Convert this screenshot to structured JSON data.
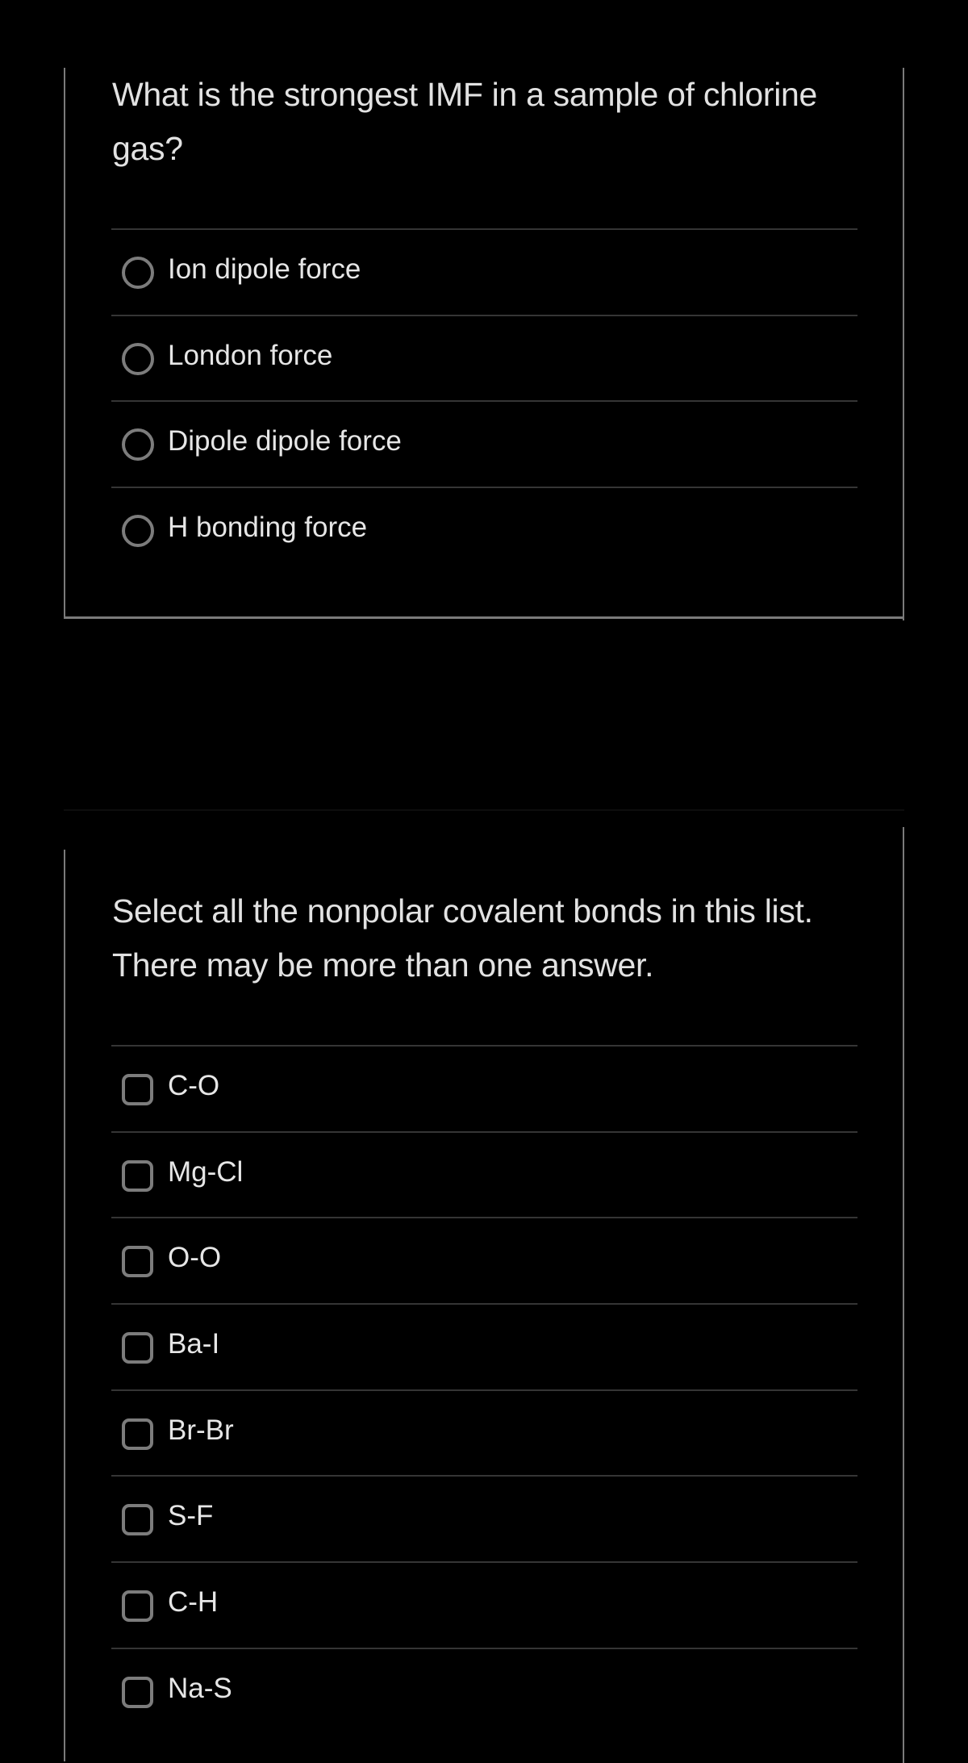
{
  "questions": [
    {
      "type": "single-choice",
      "prompt": "What is the strongest IMF in a sample of chlorine gas?",
      "options": [
        {
          "label": "Ion dipole force",
          "selected": false
        },
        {
          "label": "London force",
          "selected": false
        },
        {
          "label": "Dipole dipole force",
          "selected": false
        },
        {
          "label": "H bonding force",
          "selected": false
        }
      ]
    },
    {
      "type": "multiple-choice",
      "prompt": "Select all the nonpolar covalent bonds in this list. There may be more than one answer.",
      "options": [
        {
          "label": "C-O",
          "checked": false
        },
        {
          "label": "Mg-Cl",
          "checked": false
        },
        {
          "label": "O-O",
          "checked": false
        },
        {
          "label": "Ba-I",
          "checked": false
        },
        {
          "label": "Br-Br",
          "checked": false
        },
        {
          "label": "S-F",
          "checked": false
        },
        {
          "label": "C-H",
          "checked": false
        },
        {
          "label": "Na-S",
          "checked": false
        }
      ]
    }
  ],
  "colors": {
    "background": "#000000",
    "text": "#e4e4e4",
    "card_border": "#7a7a7a",
    "divider": "#353535",
    "control_border": "#7c7c7c"
  }
}
